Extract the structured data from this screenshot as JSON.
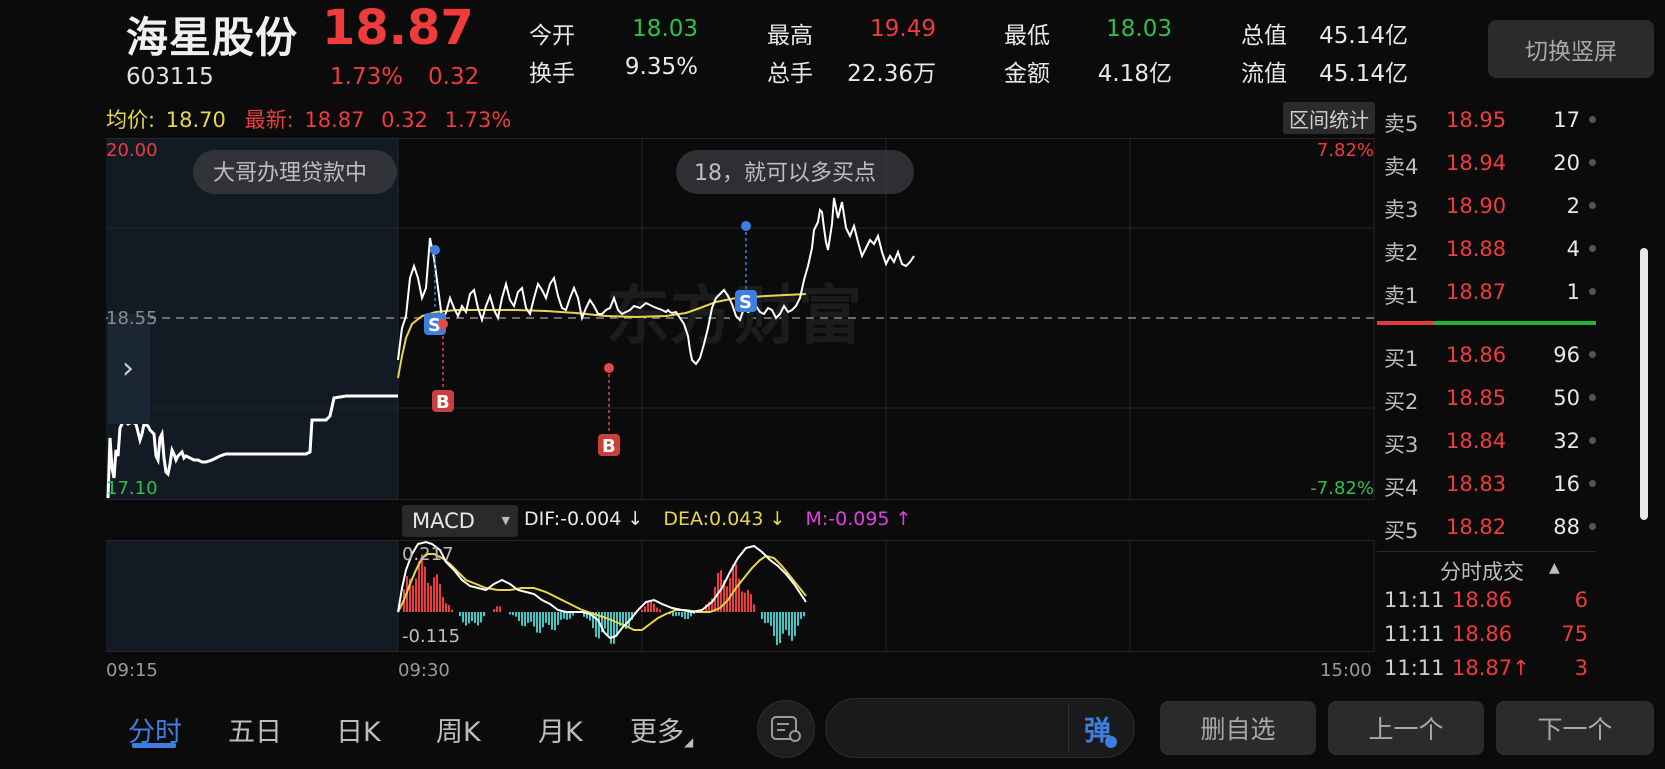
{
  "header": {
    "name": "海星股份",
    "price": "18.87",
    "code": "603115",
    "change_pct": "1.73%",
    "change_val": "0.32",
    "quote": [
      {
        "label": "今开",
        "value": "18.03",
        "color": "#2ec04a"
      },
      {
        "label": "最高",
        "value": "19.49",
        "color": "#ef3b3b"
      },
      {
        "label": "最低",
        "value": "18.03",
        "color": "#2ec04a"
      },
      {
        "label": "总值",
        "value": "45.14亿",
        "color": "#e8e8e8"
      },
      {
        "label": "换手",
        "value": "9.35%",
        "color": "#e8e8e8"
      },
      {
        "label": "总手",
        "value": "22.36万",
        "color": "#e8e8e8"
      },
      {
        "label": "金额",
        "value": "4.18亿",
        "color": "#e8e8e8"
      },
      {
        "label": "流值",
        "value": "45.14亿",
        "color": "#e8e8e8"
      }
    ],
    "switch_label": "切换竖屏"
  },
  "info_line": {
    "avg_label": "均价:",
    "avg_value": "18.70",
    "latest_label": "最新:",
    "latest_value": "18.87",
    "latest_change": "0.32",
    "latest_pct": "1.73%",
    "range_stat_label": "区间统计"
  },
  "chart_labels": {
    "y_top": "20.00",
    "y_mid": "18.55",
    "y_bottom": "17.10",
    "pct_top": "7.82%",
    "pct_bottom": "-7.82%",
    "t_start": "09:15",
    "t_open": "09:30",
    "t_end": "15:00",
    "bubble_left": "大哥办理贷款中",
    "bubble_right": "18，就可以多买点",
    "macd_top": "0.217",
    "macd_bottom": "-0.115",
    "marker_s": "S",
    "marker_b": "B",
    "expand_arrow": "›"
  },
  "macd": {
    "select_label": "MACD",
    "dif": "DIF:-0.004 ↓",
    "dea": "DEA:0.043 ↓",
    "m": "M:-0.095 ↑"
  },
  "order_book": {
    "asks": [
      {
        "label": "卖5",
        "price": "18.95",
        "volume": "17"
      },
      {
        "label": "卖4",
        "price": "18.94",
        "volume": "20"
      },
      {
        "label": "卖3",
        "price": "18.90",
        "volume": "2"
      },
      {
        "label": "卖2",
        "price": "18.88",
        "volume": "4"
      },
      {
        "label": "卖1",
        "price": "18.87",
        "volume": "1"
      }
    ],
    "bids": [
      {
        "label": "买1",
        "price": "18.86",
        "volume": "96"
      },
      {
        "label": "买2",
        "price": "18.85",
        "volume": "50"
      },
      {
        "label": "买3",
        "price": "18.84",
        "volume": "32"
      },
      {
        "label": "买4",
        "price": "18.83",
        "volume": "16"
      },
      {
        "label": "买5",
        "price": "18.82",
        "volume": "88"
      }
    ]
  },
  "ticks": {
    "header": "分时成交",
    "header_arrow": "▲",
    "rows": [
      {
        "time": "11:11",
        "price": "18.86",
        "volume": "6"
      },
      {
        "time": "11:11",
        "price": "18.86",
        "volume": "75"
      },
      {
        "time": "11:11",
        "price": "18.87↑",
        "volume": "3"
      }
    ]
  },
  "bottom_nav": {
    "tabs": [
      "分时",
      "五日",
      "日K",
      "周K",
      "月K",
      "更多"
    ],
    "more_arrow": "◢",
    "danmu_label": "弹",
    "buttons": [
      "删自选",
      "上一个",
      "下一个"
    ]
  },
  "colors": {
    "up": "#ef3b3b",
    "down": "#2ec04a",
    "avg_line": "#e8d54a",
    "accent": "#3d7fe0",
    "hist_neg": "#3ec9c9"
  }
}
